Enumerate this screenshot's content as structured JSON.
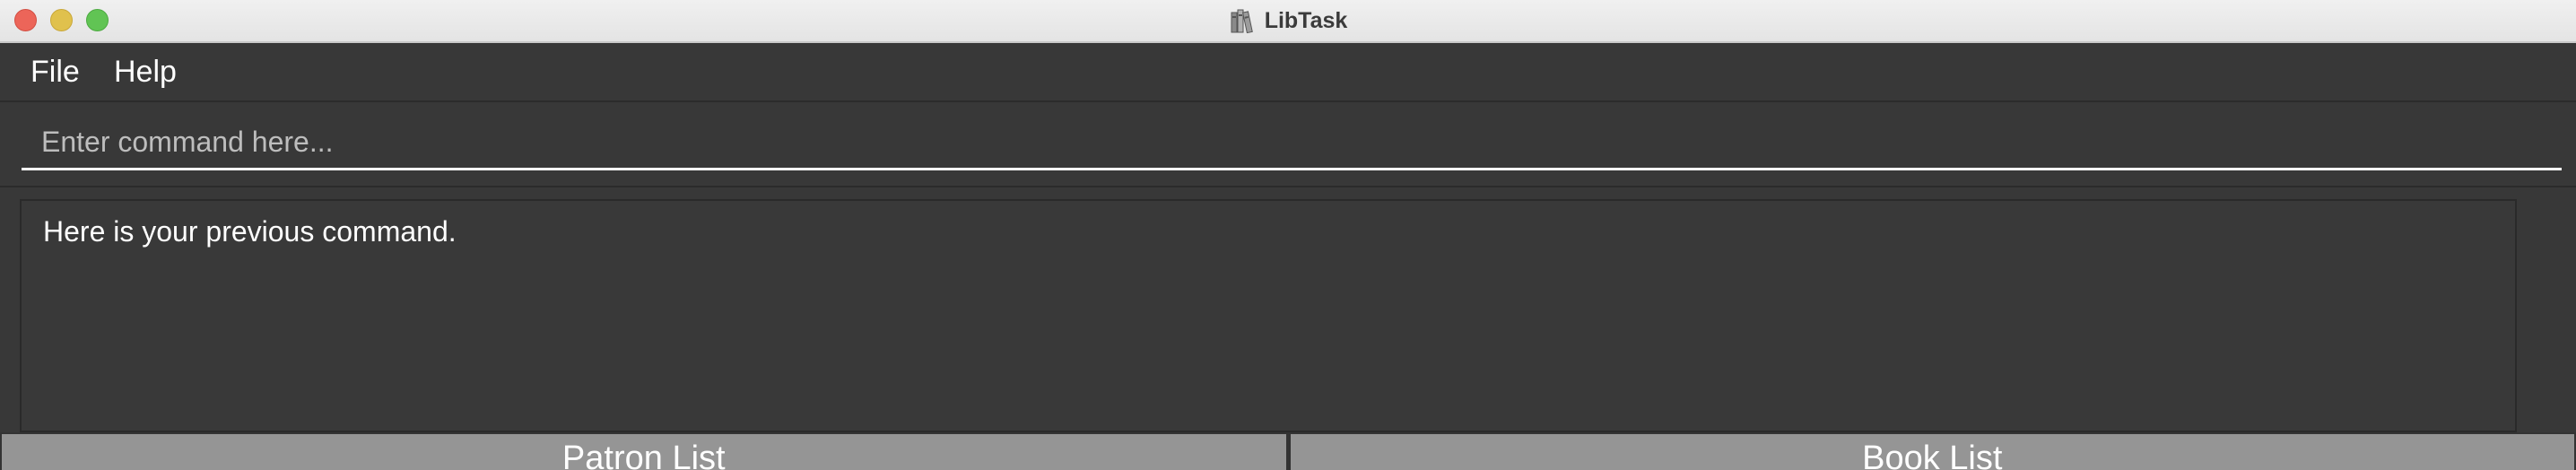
{
  "window": {
    "title": "LibTask",
    "app_icon": "books-icon"
  },
  "menu": {
    "items": [
      {
        "label": "File"
      },
      {
        "label": "Help"
      }
    ]
  },
  "command": {
    "placeholder": "Enter command here...",
    "value": ""
  },
  "result": {
    "text": "Here is your previous command."
  },
  "tabs": [
    {
      "label": "Patron List"
    },
    {
      "label": "Book List"
    }
  ],
  "colors": {
    "background": "#383838",
    "tab_background": "#959595",
    "title_bar": "#e8e8e8",
    "close": "#ec6559",
    "minimize": "#e0c14d",
    "maximize": "#61c454"
  }
}
